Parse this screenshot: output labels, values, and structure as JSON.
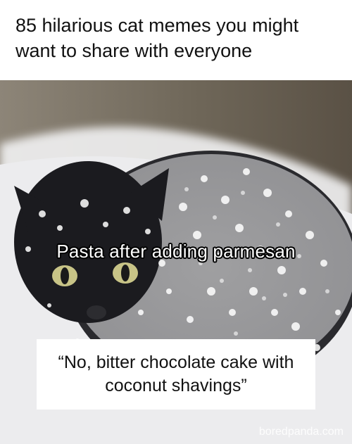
{
  "header": {
    "title": "85 hilarious cat memes you might want to share with everyone"
  },
  "meme": {
    "image_icon": "snow-covered-black-cat",
    "caption": "Pasta after adding parmesan",
    "quote": "“No, bitter chocolate cake with coconut shavings”",
    "watermark": "boredpanda.com"
  }
}
